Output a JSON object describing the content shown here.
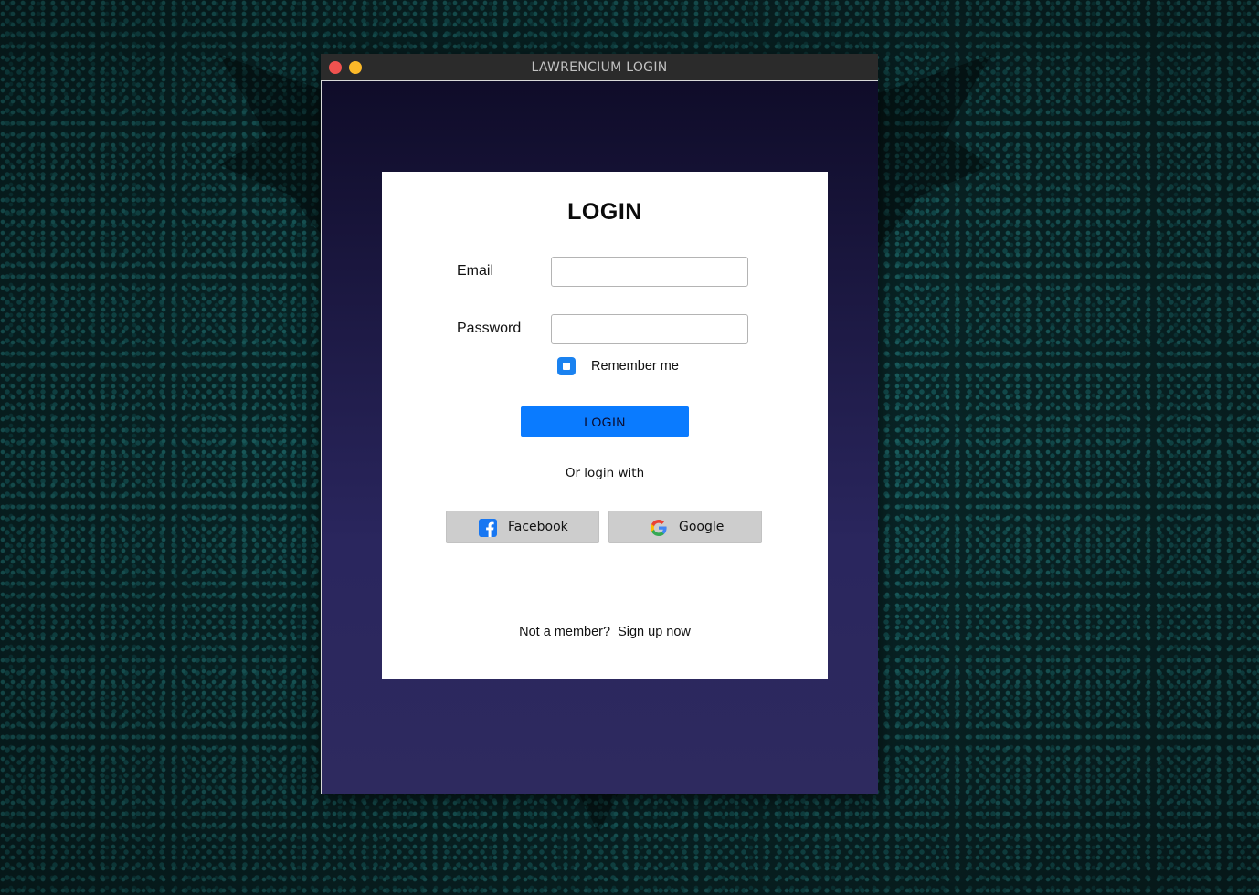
{
  "window": {
    "title": "LAWRENCIUM LOGIN"
  },
  "login_form": {
    "heading": "LOGIN",
    "email_label": "Email",
    "email_value": "",
    "password_label": "Password",
    "password_value": "",
    "remember_me_label": "Remember me",
    "remember_me_checked": true,
    "login_button_label": "LOGIN",
    "or_login_with": "Or login with",
    "social": {
      "facebook_label": "Facebook",
      "google_label": "Google"
    },
    "signup_prompt": "Not a member?",
    "signup_link": "Sign up now"
  },
  "colors": {
    "titlebar": "#2b2b2b",
    "close_button": "#f0524f",
    "minimize_button": "#fbb929",
    "accent": "#0a7bff",
    "social_button_bg": "#cdcdcd",
    "window_gradient_top": "#0f0c29",
    "window_gradient_bottom": "#2e2a5f",
    "facebook_blue": "#1877f2"
  },
  "icons": {
    "facebook": "facebook-icon",
    "google": "google-icon"
  }
}
